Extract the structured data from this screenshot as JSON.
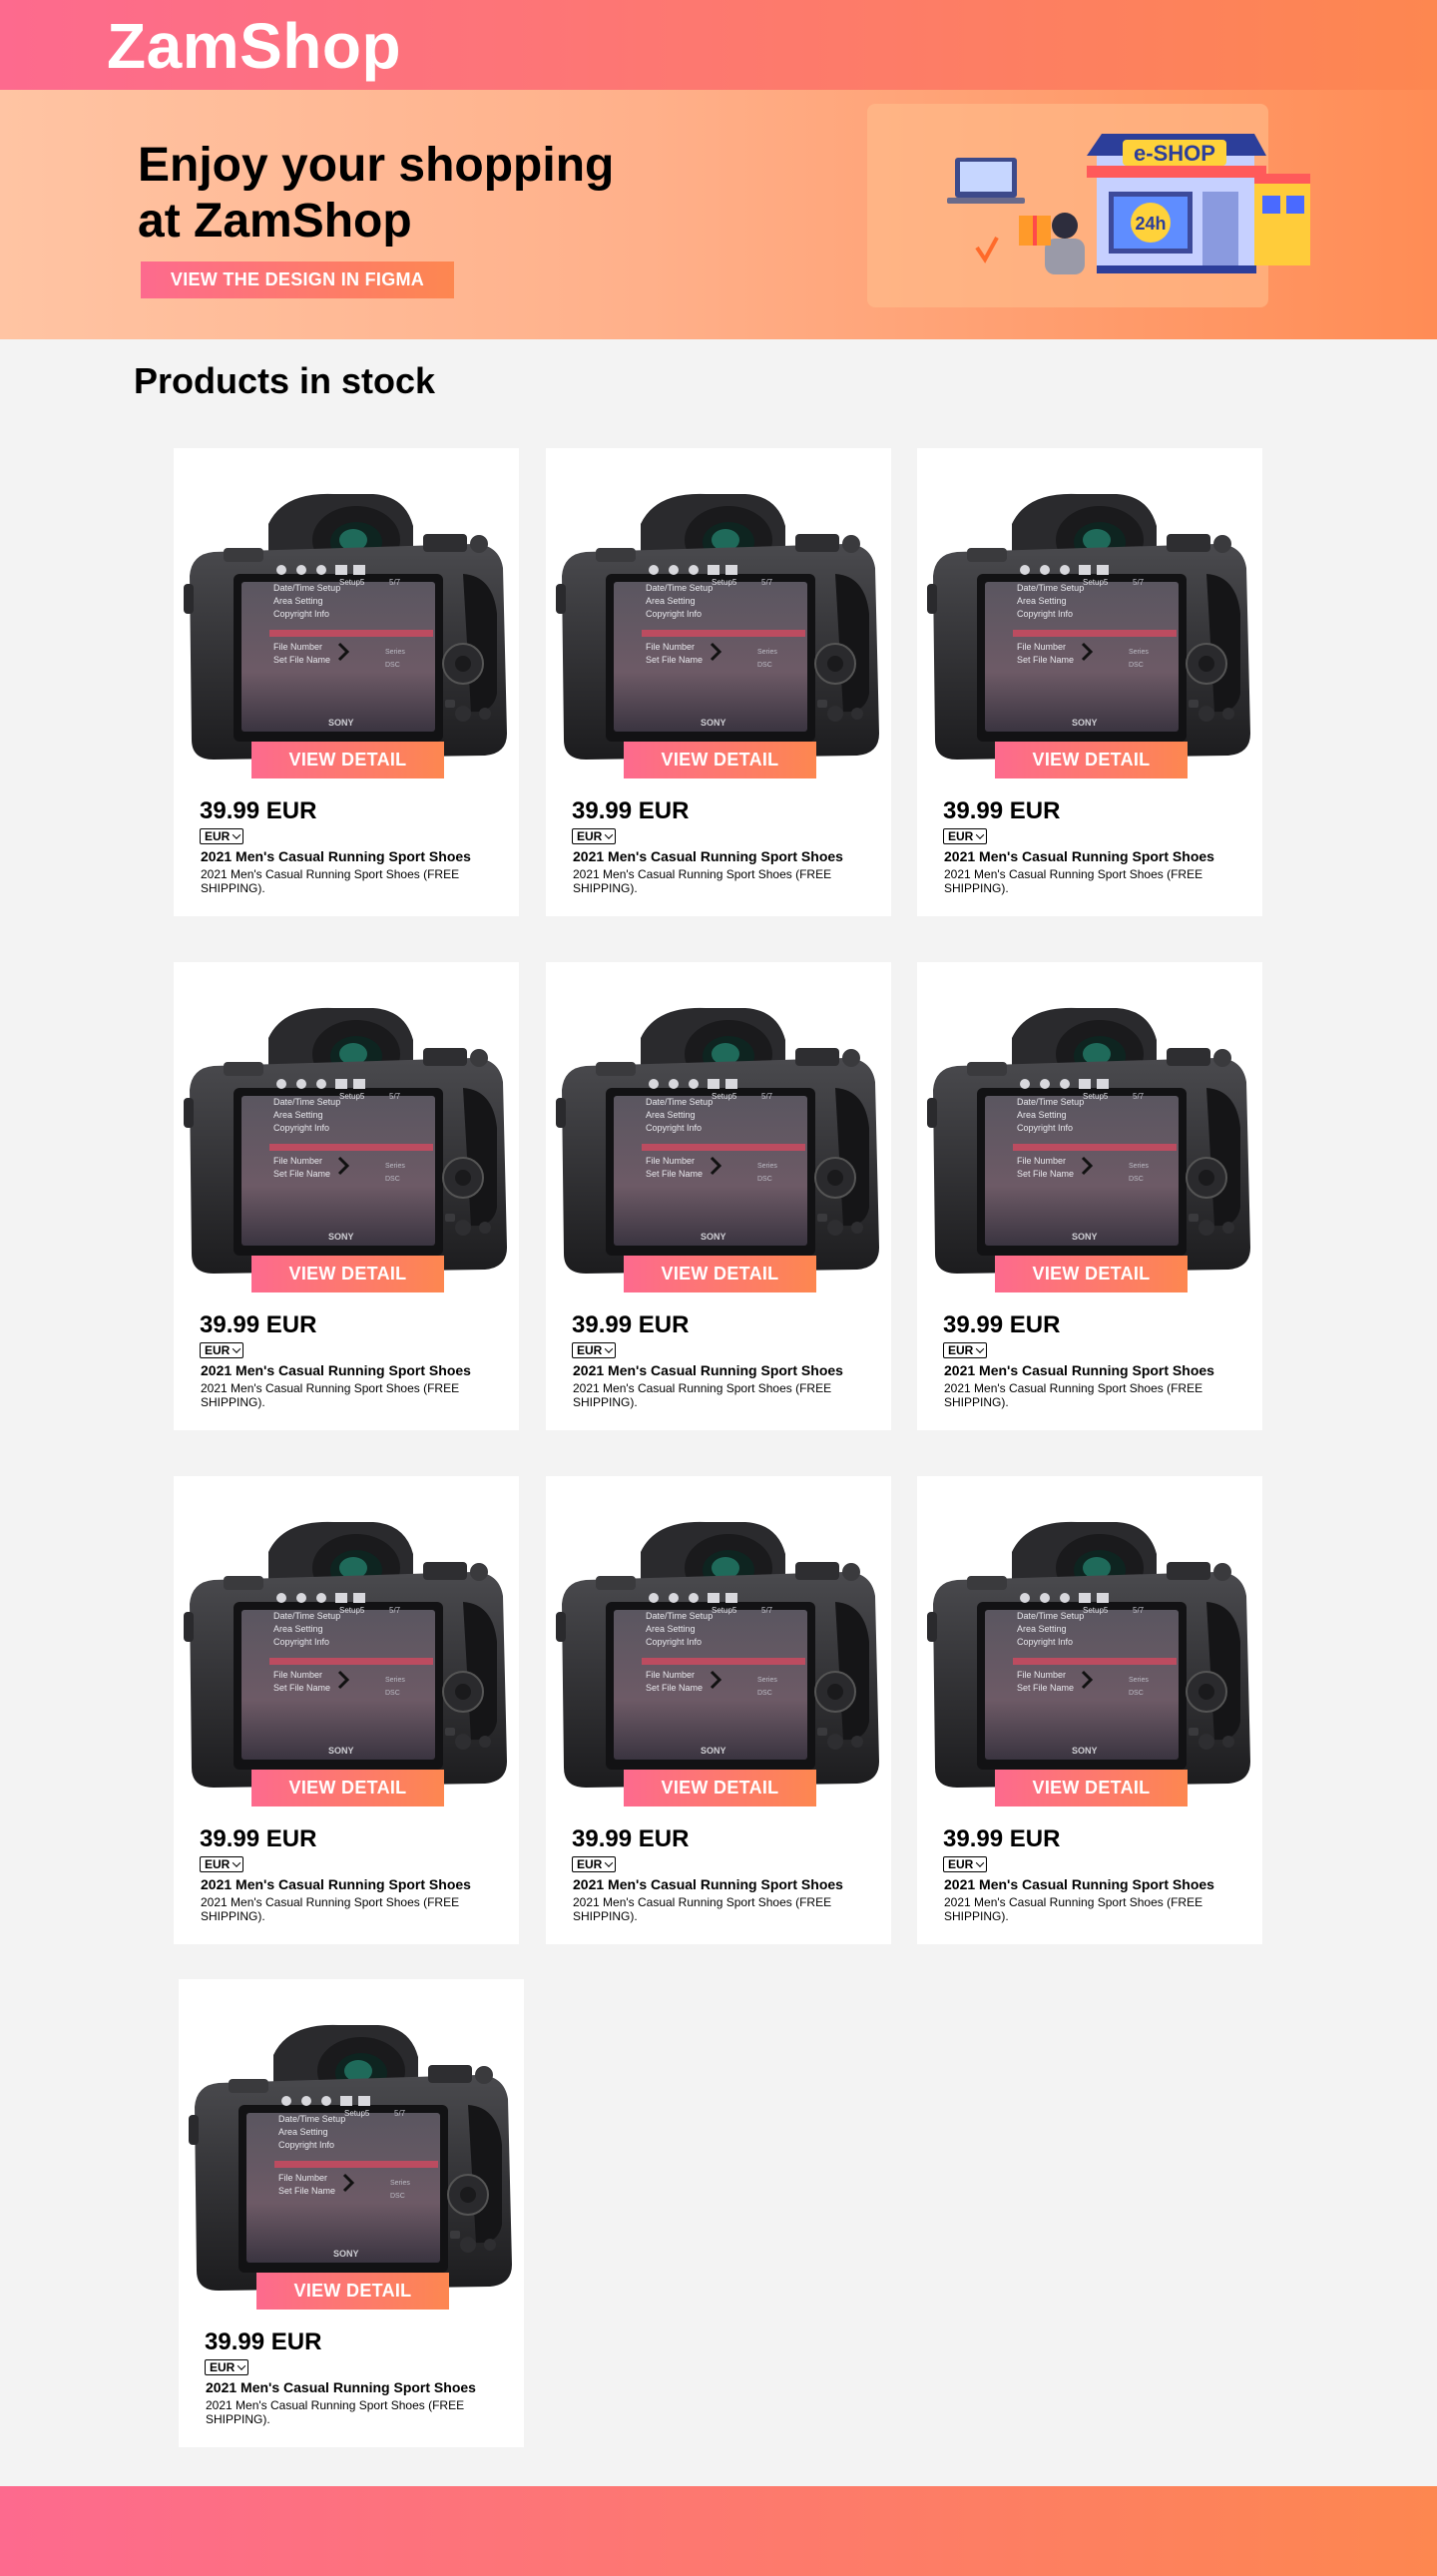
{
  "header": {
    "logo": "ZamShop"
  },
  "hero": {
    "title_line1": "Enjoy your shopping",
    "title_line2": "at ZamShop",
    "button": "VIEW THE DESIGN IN FIGMA",
    "illustration_sign": "e-SHOP",
    "illustration_clock": "24h"
  },
  "products_section": {
    "title": "Products in stock"
  },
  "camera_screen": {
    "tab": "Setup5",
    "page": "5/7",
    "items": [
      "Date/Time Setup",
      "Area Setting",
      "Copyright Info",
      "File Number",
      "Set File Name"
    ],
    "values": [
      "Series",
      "DSC"
    ],
    "brand": "SONY"
  },
  "products": [
    {
      "view_label": "VIEW DETAIL",
      "price": "39.99 EUR",
      "currency": "EUR",
      "name": "2021 Men's Casual Running Sport Shoes",
      "description": "2021 Men's Casual Running Sport Shoes (FREE SHIPPING)."
    },
    {
      "view_label": "VIEW DETAIL",
      "price": "39.99 EUR",
      "currency": "EUR",
      "name": "2021 Men's Casual Running Sport Shoes",
      "description": "2021 Men's Casual Running Sport Shoes (FREE SHIPPING)."
    },
    {
      "view_label": "VIEW DETAIL",
      "price": "39.99 EUR",
      "currency": "EUR",
      "name": "2021 Men's Casual Running Sport Shoes",
      "description": "2021 Men's Casual Running Sport Shoes (FREE SHIPPING)."
    },
    {
      "view_label": "VIEW DETAIL",
      "price": "39.99 EUR",
      "currency": "EUR",
      "name": "2021 Men's Casual Running Sport Shoes",
      "description": "2021 Men's Casual Running Sport Shoes (FREE SHIPPING)."
    },
    {
      "view_label": "VIEW DETAIL",
      "price": "39.99 EUR",
      "currency": "EUR",
      "name": "2021 Men's Casual Running Sport Shoes",
      "description": "2021 Men's Casual Running Sport Shoes (FREE SHIPPING)."
    },
    {
      "view_label": "VIEW DETAIL",
      "price": "39.99 EUR",
      "currency": "EUR",
      "name": "2021 Men's Casual Running Sport Shoes",
      "description": "2021 Men's Casual Running Sport Shoes (FREE SHIPPING)."
    },
    {
      "view_label": "VIEW DETAIL",
      "price": "39.99 EUR",
      "currency": "EUR",
      "name": "2021 Men's Casual Running Sport Shoes",
      "description": "2021 Men's Casual Running Sport Shoes (FREE SHIPPING)."
    },
    {
      "view_label": "VIEW DETAIL",
      "price": "39.99 EUR",
      "currency": "EUR",
      "name": "2021 Men's Casual Running Sport Shoes",
      "description": "2021 Men's Casual Running Sport Shoes (FREE SHIPPING)."
    },
    {
      "view_label": "VIEW DETAIL",
      "price": "39.99 EUR",
      "currency": "EUR",
      "name": "2021 Men's Casual Running Sport Shoes",
      "description": "2021 Men's Casual Running Sport Shoes (FREE SHIPPING)."
    },
    {
      "view_label": "VIEW DETAIL",
      "price": "39.99 EUR",
      "currency": "EUR",
      "name": "2021 Men's Casual Running Sport Shoes",
      "description": "2021 Men's Casual Running Sport Shoes (FREE SHIPPING)."
    }
  ],
  "colors": {
    "brand_gradient_start": "#fd6a8e",
    "brand_gradient_end": "#fd8750",
    "page_background": "#f3f3f3",
    "card_background": "#ffffff"
  },
  "icons": {
    "product_image": "camera-icon",
    "currency_dropdown": "chevron-down-icon",
    "hero_illustration": "storefront-icon"
  }
}
